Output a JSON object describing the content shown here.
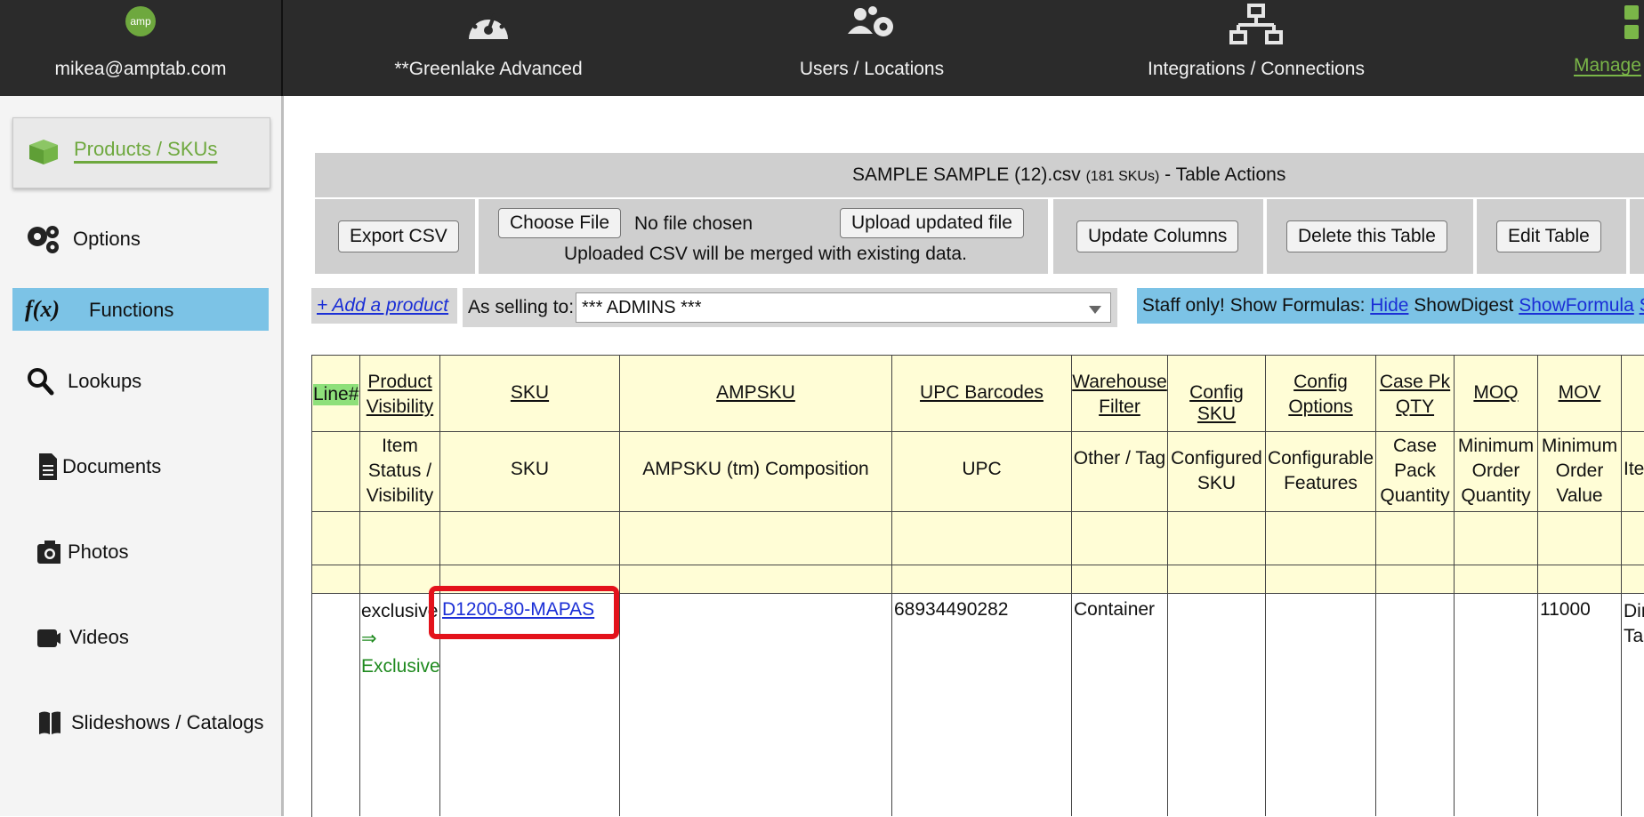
{
  "topbar": {
    "account": "mikea@amptab.com",
    "dashboard": "**Greenlake Advanced",
    "users": "Users / Locations",
    "integrations": "Integrations / Connections",
    "manage": "Manage",
    "logo_text": "amp"
  },
  "sidebar": {
    "items": [
      {
        "label": "Products / SKUs",
        "icon": "box-icon"
      },
      {
        "label": "Options",
        "icon": "gears-icon"
      },
      {
        "label": "Functions",
        "icon": "function-icon"
      },
      {
        "label": "Lookups",
        "icon": "search-icon"
      },
      {
        "label": "Documents",
        "icon": "document-icon"
      },
      {
        "label": "Photos",
        "icon": "camera-icon"
      },
      {
        "label": "Videos",
        "icon": "video-icon"
      },
      {
        "label": "Slideshows / Catalogs",
        "icon": "book-icon"
      }
    ]
  },
  "actions": {
    "title_file": "SAMPLE SAMPLE (12).csv",
    "title_count": "(181 SKUs)",
    "title_suffix": "- Table Actions",
    "export_csv": "Export CSV",
    "choose_file": "Choose File",
    "no_file": "No file chosen",
    "upload": "Upload updated file",
    "merge_note": "Uploaded CSV will be merged with existing data.",
    "update_columns": "Update Columns",
    "delete_table": "Delete this Table",
    "edit_table": "Edit Table"
  },
  "selling": {
    "add_product": "+ Add a product",
    "label": "As selling to:",
    "selected": "*** ADMINS ***"
  },
  "staff": {
    "prefix": "Staff only! Show Formulas:",
    "hide": "Hide",
    "show_digest": "ShowDigest",
    "show_formula": "ShowFormula",
    "more": "S"
  },
  "table": {
    "headers": [
      "Line#",
      "Product Visibility",
      "SKU",
      "AMPSKU",
      "UPC Barcodes",
      "Warehouse Filter",
      "Config SKU",
      "Config Options",
      "Case Pk QTY",
      "MOQ",
      "MOV",
      ""
    ],
    "subheaders": [
      "",
      "Item Status / Visibility",
      "SKU",
      "AMPSKU (tm) Composition",
      "UPC",
      "Other / Tag",
      "Configured SKU",
      "Configurable Features",
      "Case Pack Quantity",
      "Minimum Order Quantity",
      "Minimum Order Value",
      "Ite"
    ],
    "row": {
      "line": "",
      "visibility_status": "exclusive",
      "visibility_arrow": "⇒",
      "visibility_value": "Exclusive",
      "sku": "D1200-80-MAPAS",
      "ampsku": "",
      "upc": "68934490282",
      "warehouse": "Container",
      "config_sku": "",
      "config_options": "",
      "case_pk": "",
      "moq": "",
      "mov": "11000",
      "extra": "Dir Ta"
    }
  },
  "colors": {
    "topbar": "#2b2b2b",
    "accent_green": "#7ab648",
    "highlight_blue": "#7cc3e6",
    "header_yellow": "#fffdd6",
    "line_green": "#8ee07a",
    "callout_red": "#e3121b"
  }
}
